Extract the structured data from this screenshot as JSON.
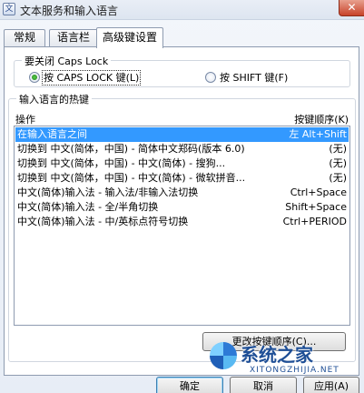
{
  "window": {
    "title": "文本服务和输入语言",
    "close_label": "✕"
  },
  "tabs": [
    {
      "label": "常规"
    },
    {
      "label": "语言栏"
    },
    {
      "label": "高级键设置"
    }
  ],
  "caps_group": {
    "legend": "要关闭 Caps Lock",
    "option1": "按 CAPS LOCK 键(L)",
    "option2": "按 SHIFT 键(F)",
    "selected": "option1"
  },
  "hotkey_group": {
    "legend": "输入语言的热键",
    "col_action": "操作",
    "col_sequence": "按键顺序(K)",
    "rows": [
      {
        "action": "在输入语言之间",
        "keys": "左 Alt+Shift",
        "selected": true
      },
      {
        "action": "切换到 中文(简体，中国) - 简体中文郑码(版本 6.0)",
        "keys": "(无)"
      },
      {
        "action": "切换到 中文(简体，中国) - 中文(简体) - 搜狗...",
        "keys": "(无)"
      },
      {
        "action": "切换到 中文(简体，中国) - 中文(简体) - 微软拼音...",
        "keys": "(无)"
      },
      {
        "action": "中文(简体)输入法 - 输入法/非输入法切换",
        "keys": "Ctrl+Space"
      },
      {
        "action": "中文(简体)输入法 - 全/半角切换",
        "keys": "Shift+Space"
      },
      {
        "action": "中文(简体)输入法 - 中/英标点符号切换",
        "keys": "Ctrl+PERIOD"
      }
    ],
    "change_button": "更改按键顺序(C)..."
  },
  "footer": {
    "ok": "确定",
    "cancel": "取消",
    "apply": "应用(A)"
  },
  "watermark": {
    "text": "系统之家",
    "sub": "XITONGZHIJIA.NET"
  }
}
